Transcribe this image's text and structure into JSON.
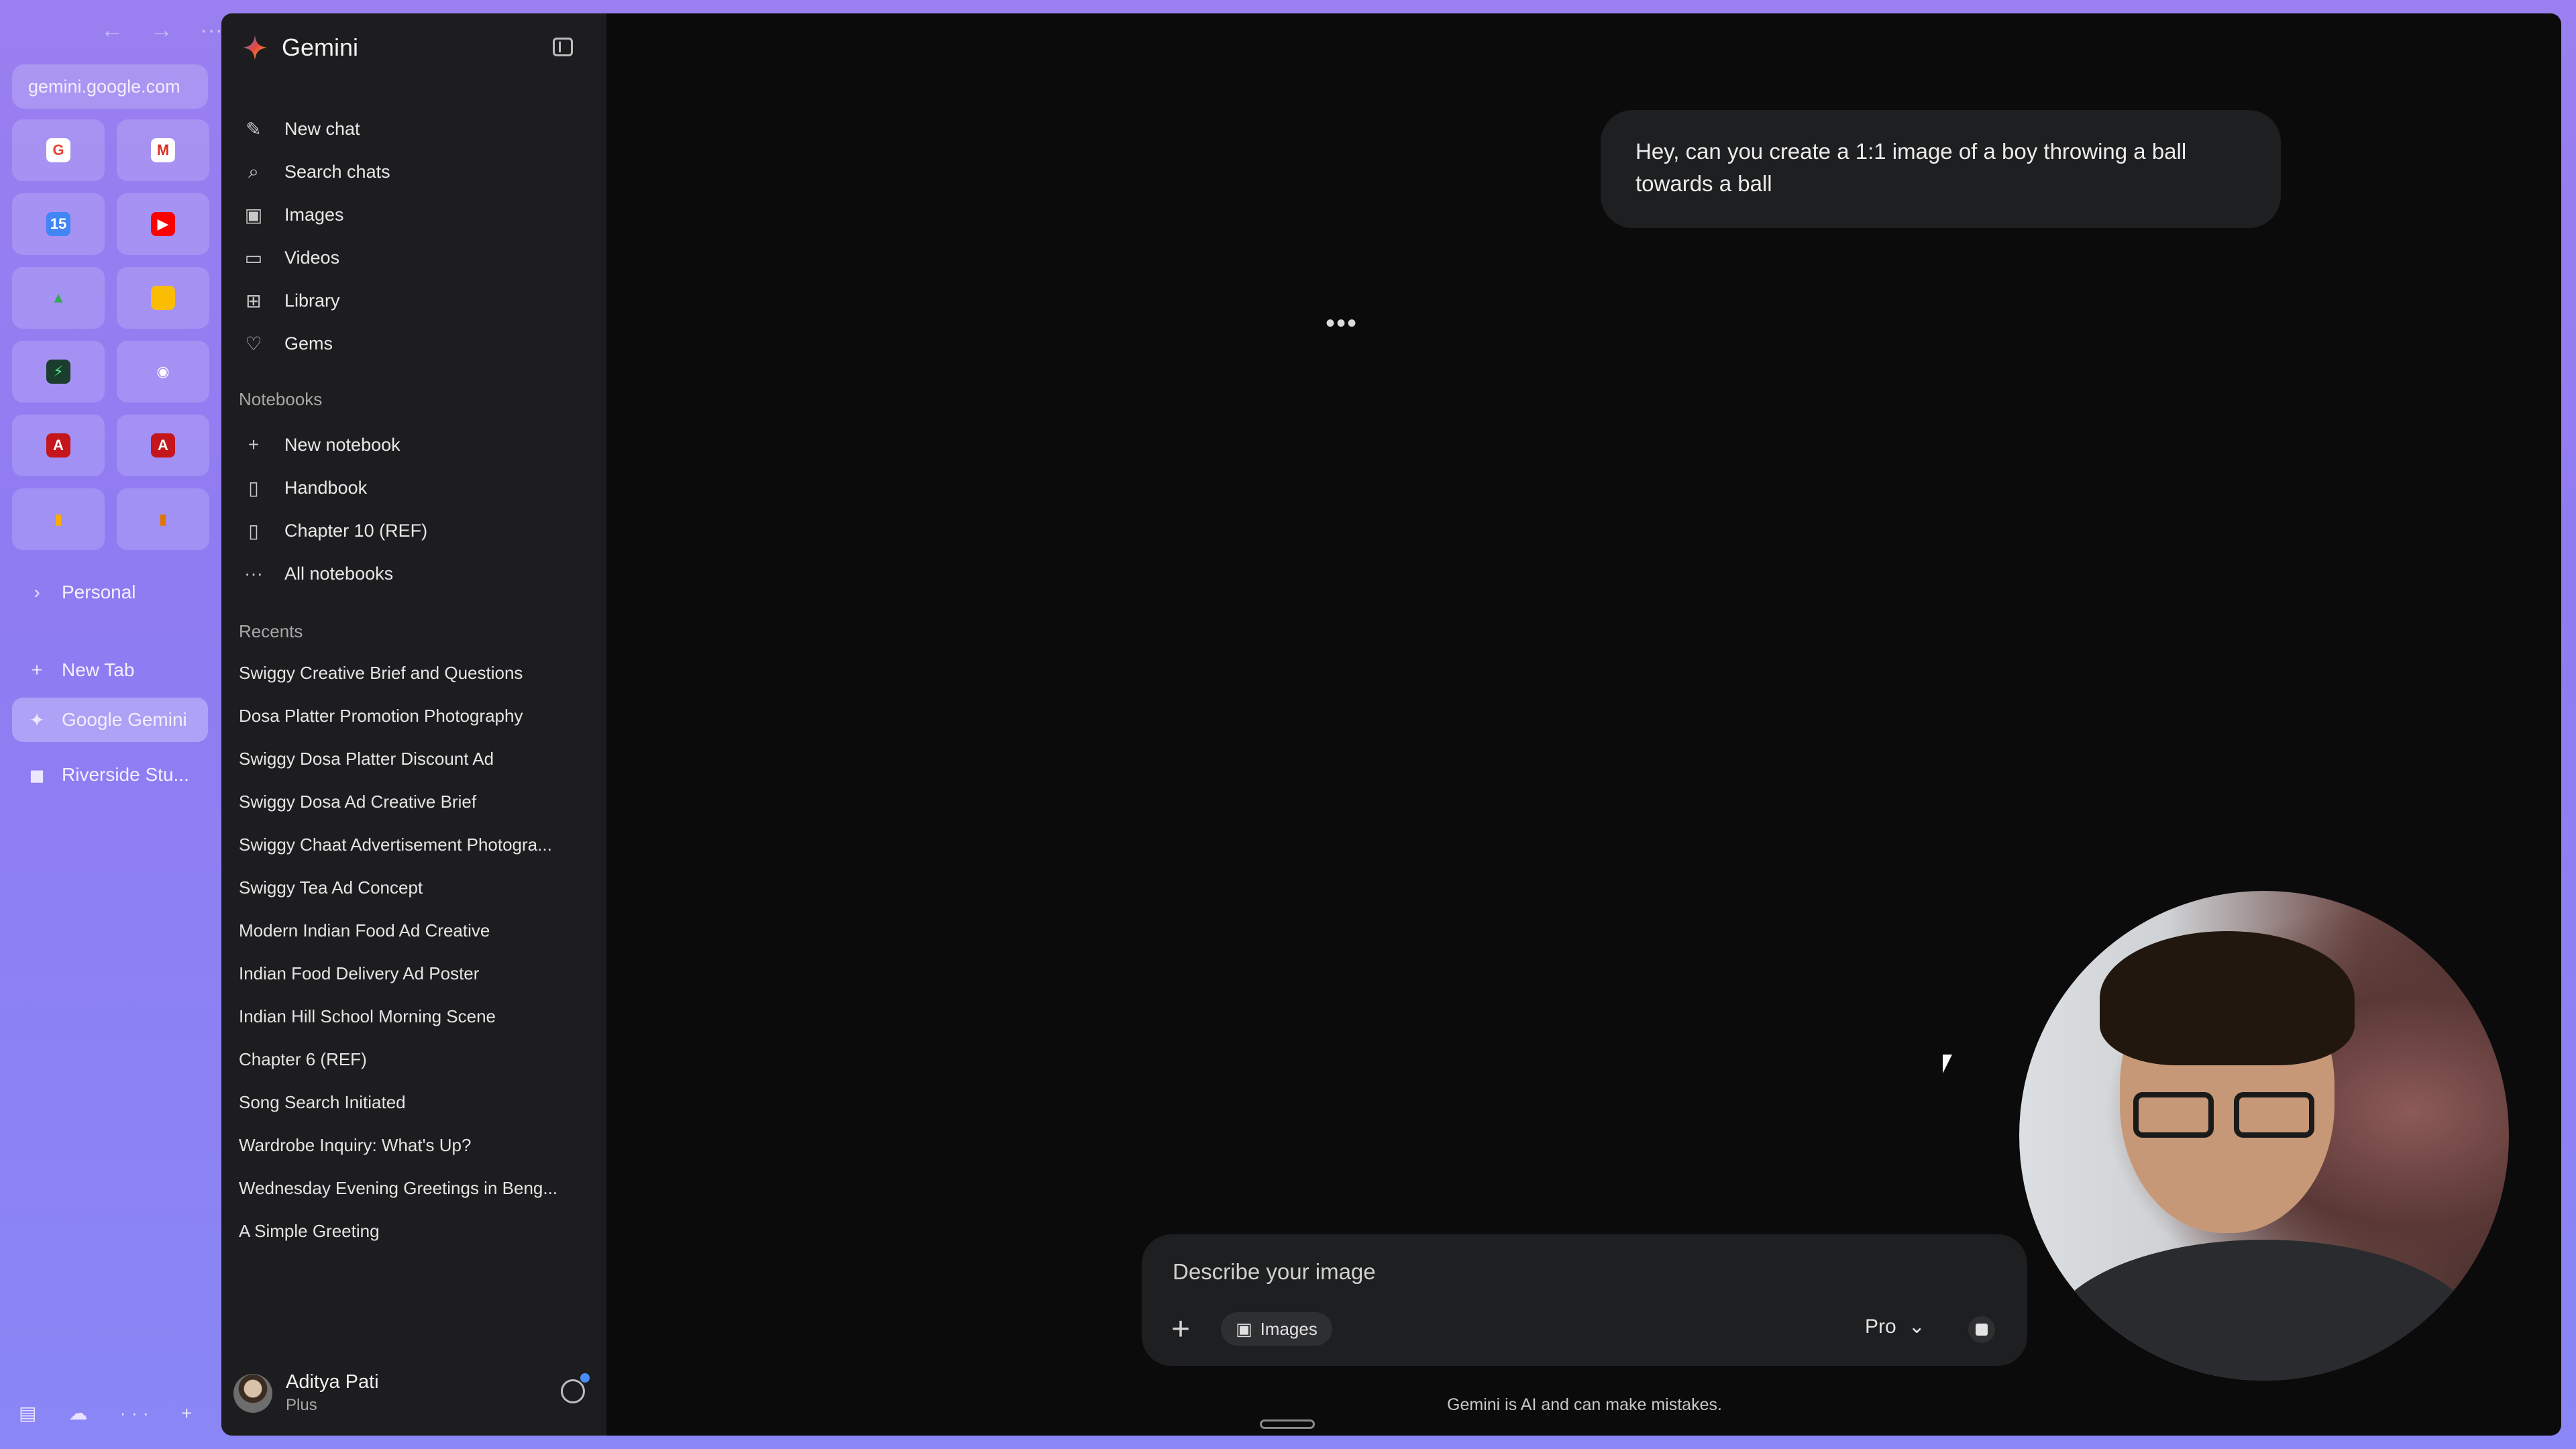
{
  "browser": {
    "url": "gemini.google.com",
    "nav": {
      "back": "←",
      "forward": "→",
      "more": "···"
    },
    "favorites": [
      {
        "icon": "google-icon",
        "glyph": "G",
        "color": "#ffffff",
        "text_color": "#ea4335"
      },
      {
        "icon": "gmail-icon",
        "glyph": "M",
        "color": "#ffffff",
        "text_color": "#d93025"
      },
      {
        "icon": "calendar-icon",
        "glyph": "15",
        "color": "#4285f4",
        "text_color": "#ffffff"
      },
      {
        "icon": "youtube-icon",
        "glyph": "▶",
        "color": "#ff0000",
        "text_color": "#ffffff"
      },
      {
        "icon": "google-drive-icon",
        "glyph": "▲",
        "color": "transparent",
        "text_color": "#34a853"
      },
      {
        "icon": "google-keep-icon",
        "glyph": "■",
        "color": "#fbbc04",
        "text_color": "#fbbc04"
      },
      {
        "icon": "activity-app-icon",
        "glyph": "⚡",
        "color": "#1a3d2e",
        "text_color": "#4ee08a"
      },
      {
        "icon": "github-icon",
        "glyph": "◉",
        "color": "transparent",
        "text_color": "#ffffff"
      },
      {
        "icon": "acrobat-icon",
        "glyph": "A",
        "color": "#c4161c",
        "text_color": "#ffffff"
      },
      {
        "icon": "acrobat-icon-2",
        "glyph": "A",
        "color": "#c4161c",
        "text_color": "#ffffff"
      },
      {
        "icon": "analytics-icon",
        "glyph": "▮",
        "color": "transparent",
        "text_color": "#f9ab00"
      },
      {
        "icon": "analytics-icon-2",
        "glyph": "▮",
        "color": "transparent",
        "text_color": "#e37400"
      }
    ],
    "items": [
      {
        "name": "folder-personal",
        "icon": "›",
        "label": "Personal"
      },
      {
        "name": "new-tab",
        "icon": "+",
        "label": "New Tab"
      },
      {
        "name": "tab-google-gemini",
        "icon": "✦",
        "label": "Google Gemini",
        "active": true
      },
      {
        "name": "tab-riverside",
        "icon": "◼",
        "label": "Riverside Stu..."
      }
    ]
  },
  "sidebar": {
    "brand": "Gemini",
    "nav": [
      {
        "name": "nav-new-chat",
        "icon": "✎",
        "label": "New chat"
      },
      {
        "name": "nav-search-chats",
        "icon": "⌕",
        "label": "Search chats"
      },
      {
        "name": "nav-images",
        "icon": "▣",
        "label": "Images"
      },
      {
        "name": "nav-videos",
        "icon": "▭",
        "label": "Videos"
      },
      {
        "name": "nav-library",
        "icon": "⊞",
        "label": "Library"
      },
      {
        "name": "nav-gems",
        "icon": "♡",
        "label": "Gems"
      }
    ],
    "notebooks_title": "Notebooks",
    "notebooks": [
      {
        "name": "notebook-new",
        "icon": "+",
        "label": "New notebook"
      },
      {
        "name": "notebook-handbook",
        "icon": "▯",
        "label": "Handbook"
      },
      {
        "name": "notebook-chapter-10",
        "icon": "▯",
        "label": "Chapter 10 (REF)"
      },
      {
        "name": "notebook-all",
        "icon": "···",
        "label": "All notebooks"
      }
    ],
    "recents_title": "Recents",
    "recents": [
      "Swiggy Creative Brief and Questions",
      "Dosa Platter Promotion Photography",
      "Swiggy Dosa Platter Discount Ad",
      "Swiggy Dosa Ad Creative Brief",
      "Swiggy Chaat Advertisement Photogra...",
      "Swiggy Tea Ad Concept",
      "Modern Indian Food Ad Creative",
      "Indian Food Delivery Ad Poster",
      "Indian Hill School Morning Scene",
      "Chapter 6 (REF)",
      "Song Search Initiated",
      "Wardrobe Inquiry: What's Up?",
      "Wednesday Evening Greetings in Beng...",
      "A Simple Greeting"
    ],
    "user": {
      "name": "Aditya Pati",
      "plan": "Plus"
    }
  },
  "chat": {
    "user_message": "Hey, can you create a 1:1 image of a boy throwing a ball towards a ball",
    "loading": "•••"
  },
  "composer": {
    "placeholder": "Describe your image",
    "tool_chip": "Images",
    "model": "Pro",
    "disclaimer": "Gemini is AI and can make mistakes."
  },
  "colors": {
    "accent_blue": "#4a8cf7",
    "window_bg": "#0b0b0c",
    "sidebar_bg": "#1d1d1f",
    "bubble_bg": "#1e1f20"
  }
}
